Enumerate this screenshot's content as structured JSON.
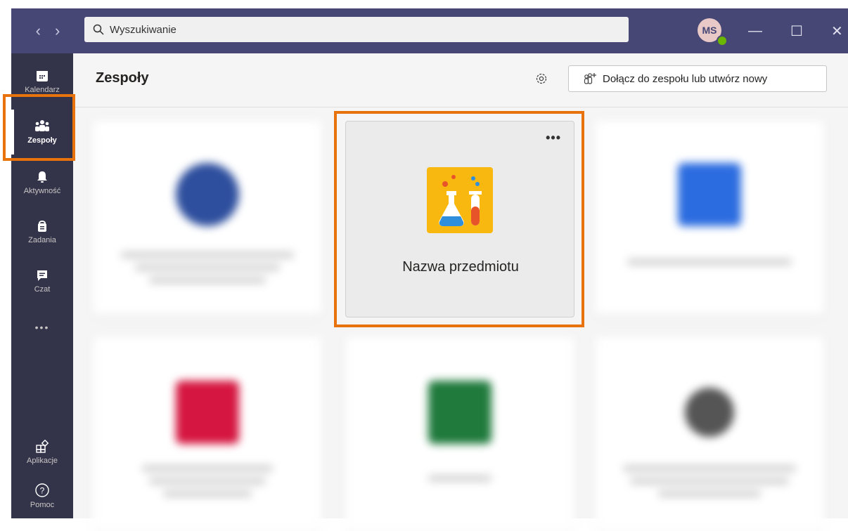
{
  "nav": {
    "back": "‹",
    "forward": "›"
  },
  "search": {
    "placeholder": "Wyszukiwanie"
  },
  "user": {
    "initials": "MS"
  },
  "window": {
    "minimize": "—",
    "maximize": "☐",
    "close": "✕"
  },
  "sidebar": {
    "items": [
      {
        "label": "Kalendarz",
        "icon": "calendar-icon"
      },
      {
        "label": "Zespoły",
        "icon": "teams-icon",
        "active": true
      },
      {
        "label": "Aktywność",
        "icon": "bell-icon"
      },
      {
        "label": "Zadania",
        "icon": "assignments-icon"
      },
      {
        "label": "Czat",
        "icon": "chat-icon"
      },
      {
        "label": "•••",
        "icon": "more-icon"
      }
    ],
    "bottom": [
      {
        "label": "Aplikacje",
        "icon": "apps-icon"
      },
      {
        "label": "Pomoc",
        "icon": "help-icon"
      }
    ]
  },
  "main": {
    "title": "Zespoły",
    "join_button": "Dołącz do zespołu lub utwórz nowy",
    "focus_card": {
      "name": "Nazwa przedmiotu",
      "more": "•••"
    }
  },
  "colors": {
    "accent": "#464775",
    "rail": "#33344a",
    "highlight": "#e8730c",
    "tile": "#f8b80f"
  }
}
